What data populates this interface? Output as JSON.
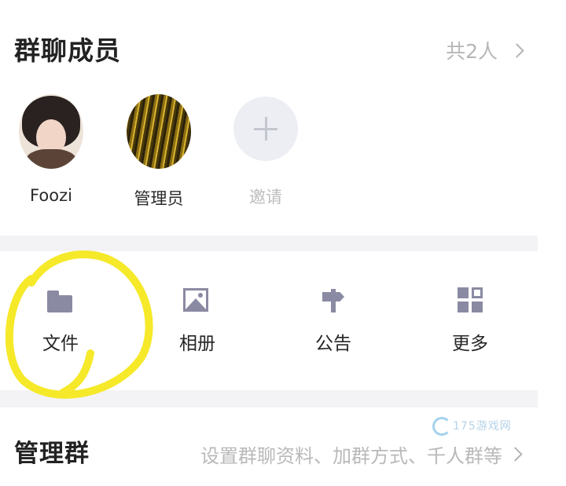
{
  "members_section": {
    "title": "群聊成员",
    "count_label": "共2人"
  },
  "members": [
    {
      "name": "Foozi",
      "avatar": "photo-avatar"
    },
    {
      "name": "管理员",
      "avatar": "gold-texture-avatar"
    }
  ],
  "invite": {
    "label": "邀请",
    "icon": "plus-icon"
  },
  "tools": [
    {
      "label": "文件",
      "icon": "folder-icon"
    },
    {
      "label": "相册",
      "icon": "image-icon"
    },
    {
      "label": "公告",
      "icon": "signpost-icon"
    },
    {
      "label": "更多",
      "icon": "grid-icon"
    }
  ],
  "manage": {
    "title": "管理群",
    "description": "设置群聊资料、加群方式、千人群等"
  },
  "watermark": {
    "text": "175游戏网"
  },
  "colors": {
    "icon": "#8b8aa3",
    "muted_text": "#b9b9b9",
    "divider": "#f3f3f6",
    "highlight": "#f5e92a"
  }
}
